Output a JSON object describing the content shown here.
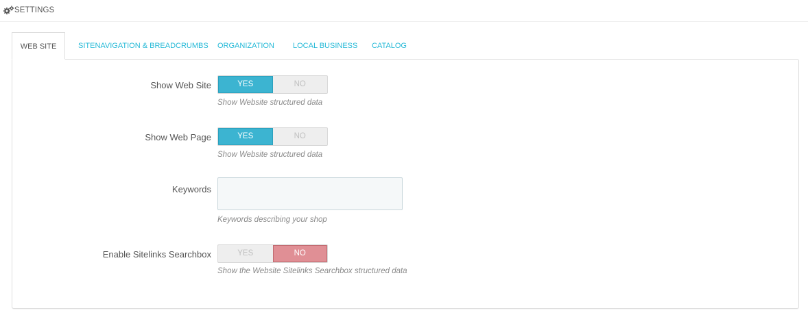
{
  "header": {
    "title": "SETTINGS",
    "icon": "cogs-icon"
  },
  "tabs": [
    {
      "label": "WEB SITE",
      "active": true
    },
    {
      "label": "SITENAVIGATION & BREADCRUMBS",
      "active": false
    },
    {
      "label": "ORGANIZATION",
      "active": false
    },
    {
      "label": "LOCAL BUSINESS",
      "active": false
    },
    {
      "label": "CATALOG",
      "active": false
    }
  ],
  "form": {
    "show_web_site": {
      "label": "Show Web Site",
      "yes_label": "YES",
      "no_label": "NO",
      "value": "yes",
      "help": "Show Website structured data"
    },
    "show_web_page": {
      "label": "Show Web Page",
      "yes_label": "YES",
      "no_label": "NO",
      "value": "yes",
      "help": "Show Website structured data"
    },
    "keywords": {
      "label": "Keywords",
      "value": "",
      "help": "Keywords describing your shop"
    },
    "sitelinks_searchbox": {
      "label": "Enable Sitelinks Searchbox",
      "yes_label": "YES",
      "no_label": "NO",
      "value": "no",
      "help": "Show the Website Sitelinks Searchbox structured data"
    }
  },
  "colors": {
    "accent": "#25b9d7",
    "yes_active": "#3cb4d1",
    "no_active": "#e08f95",
    "border": "#dddddd"
  }
}
